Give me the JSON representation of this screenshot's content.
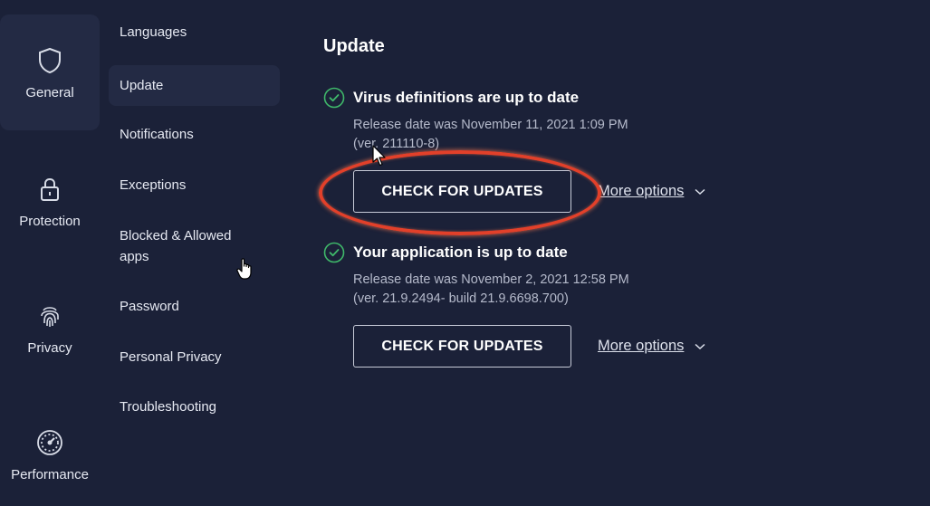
{
  "rail": {
    "items": [
      {
        "label": "General",
        "icon": "shield-icon",
        "active": true
      },
      {
        "label": "Protection",
        "icon": "lock-icon",
        "active": false
      },
      {
        "label": "Privacy",
        "icon": "fingerprint-icon",
        "active": false
      },
      {
        "label": "Performance",
        "icon": "speedometer-icon",
        "active": false
      }
    ]
  },
  "subnav": {
    "items": [
      {
        "label": "Languages"
      },
      {
        "label": "Update",
        "active": true
      },
      {
        "label": "Notifications"
      },
      {
        "label": "Exceptions"
      },
      {
        "label": "Blocked & Allowed apps"
      },
      {
        "label": "Password"
      },
      {
        "label": "Personal Privacy"
      },
      {
        "label": "Troubleshooting"
      }
    ]
  },
  "main": {
    "title": "Update",
    "sections": [
      {
        "status": "Virus definitions are up to date",
        "release": "Release date was November 11, 2021 1:09 PM",
        "version": "(ver. 211110-8)",
        "button": "CHECK FOR UPDATES",
        "more": "More options"
      },
      {
        "status": "Your application is up to date",
        "release": "Release date was November 2, 2021 12:58 PM",
        "version": "(ver. 21.9.2494- build 21.9.6698.700)",
        "button": "CHECK FOR UPDATES",
        "more": "More options"
      }
    ]
  },
  "colors": {
    "background": "#1b2138",
    "active_item": "#232a44",
    "check_green": "#3fb86a",
    "highlight_ring": "#e2402a"
  }
}
